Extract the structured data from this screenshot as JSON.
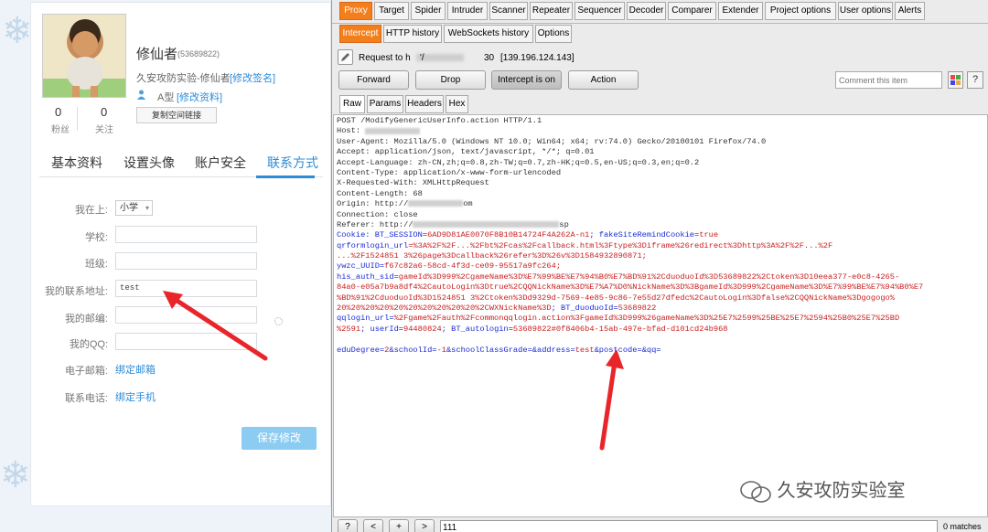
{
  "profile": {
    "name": "修仙者",
    "qq": "(53689822)",
    "signature": "久安攻防实验-修仙者",
    "edit_signature": "[修改签名]",
    "blood": "A型",
    "edit_info": "[修改资料]",
    "copy_btn": "复制空间链接",
    "fans_count": "0",
    "fans_label": "粉丝",
    "follow_count": "0",
    "follow_label": "关注"
  },
  "tabs": [
    "基本资料",
    "设置头像",
    "账户安全",
    "联系方式"
  ],
  "form": {
    "location_label": "我在上:",
    "location_value": "小学",
    "school_label": "学校:",
    "class_label": "班级:",
    "address_label": "我的联系地址:",
    "address_value": "test",
    "postcode_label": "我的邮编:",
    "qqnum_label": "我的QQ:",
    "email_label": "电子邮箱:",
    "email_link": "绑定邮箱",
    "phone_label": "联系电话:",
    "phone_link": "绑定手机",
    "save": "保存修改"
  },
  "burp": {
    "tools": [
      "Proxy",
      "Target",
      "Spider",
      "Intruder",
      "Scanner",
      "Repeater",
      "Sequencer",
      "Decoder",
      "Comparer",
      "Extender",
      "Project options",
      "User options",
      "Alerts"
    ],
    "subtabs": [
      "Intercept",
      "HTTP history",
      "WebSockets history",
      "Options"
    ],
    "request_prefix": "Request to h",
    "request_mid": "'/",
    "request_port": "30",
    "request_ip": "[139.196.124.143]",
    "buttons": {
      "forward": "Forward",
      "drop": "Drop",
      "intercept": "Intercept is on",
      "action": "Action"
    },
    "comment_placeholder": "Comment this item",
    "help": "?",
    "viewtabs": [
      "Raw",
      "Params",
      "Headers",
      "Hex"
    ],
    "lines": {
      "l1": "POST /ModifyGenericUserInfo.action HTTP/1.1",
      "l2": "Host: ",
      "l3": "User-Agent: Mozilla/5.0 (Windows NT 10.0; Win64; x64; rv:74.0) Gecko/20100101 Firefox/74.0",
      "l4": "Accept: application/json, text/javascript, */*; q=0.01",
      "l5": "Accept-Language: zh-CN,zh;q=0.8,zh-TW;q=0.7,zh-HK;q=0.5,en-US;q=0.3,en;q=0.2",
      "l6": "Content-Type: application/x-www-form-urlencoded",
      "l7": "X-Requested-With: XMLHttpRequest",
      "l8": "Content-Length: 68",
      "l9": "Origin: http://",
      "l9b": "om",
      "l10": "Connection: close",
      "l11": "Referer: http://",
      "l11b": "sp",
      "l12k": "Cookie: BT_SESSION=",
      "l12v": "6AD9D81AE0070F8B10B14724F4A262A-n1",
      "l12k2": "; fakeSiteRemindCookie=",
      "l12v2": "true",
      "l13k": "qrformlogin_url",
      "l13v": "=%3A%2F%2F...%2Fbt%2Fcas%2Fcallback.html%3Ftype%3Diframe%26redirect%3Dhttp%3A%2F%2F...%2F",
      "l14v": "...%2F1524851 3%26page%3Dcallback%26refer%3D%26v%3D1584932890871;",
      "l15k": "ywzc_UUID=",
      "l15v": "f67c82a6-58cd-4f3d-ce09-95517a9fc264;",
      "l16k": "his_auth_sid=",
      "l16v": "gameId%3D999%2CgameName%3D%E7%99%BE%E7%94%B0%E7%BD%91%2CduoduoId%3D53689822%2Ctoken%3D10eea377-e0c8-4265-",
      "l17v": "84a0-e05a7b9a8df4%2CautoLogin%3Dtrue%2CQQNickName%3D%E7%A7%D0%NickName%3D%3BgameId%3D999%2CgameName%3D%E7%99%BE%E7%94%B0%E7",
      "l18v": "%BD%91%2CduoduoId%3D1524851 3%2Ctoken%3Dd9329d-7569-4e85-9c86-7e55d27dfedc%2CautoLogin%3Dfalse%2CQQNickName%3Dgogogo%",
      "l19v": "20%20%20%20%20%20%20%20%20%20%2CWXNickName%3D",
      "l19k": "; BT_duoduoId=",
      "l19v2": "53689822",
      "l20k": "qqlogin_url=",
      "l20v": "%2Fgame%2Fauth%2Fcommonqqlogin.action%3FgameId%3D999%26gameName%3D%25E7%2599%25BE%25E7%2594%25B0%25E7%25BD",
      "l21v": "%2591",
      "l21k": "; userId=",
      "l21v2": "94480824",
      "l21k2": "; BT_autologin=",
      "l21v3": "53689822#0f8406b4-15ab-497e-bfad-d101cd24b968",
      "l22": "",
      "l23a": "eduDegree=",
      "l23b": "2",
      "l23c": "&schoolId=",
      "l23d": "-1",
      "l23e": "&schoolClassGrade=",
      "l23f": "",
      "l23g": "&address=",
      "l23h": "test",
      "l23i": "&postcode=",
      "l23j": "",
      "l23k": "&qq=",
      "l23l": ""
    },
    "search_value": "111",
    "matches": "0 matches",
    "nav_btns": [
      "?",
      "<",
      "+",
      ">"
    ]
  },
  "watermark": "久安攻防实验室",
  "colors": {
    "accent": "#f37f1c",
    "link": "#2d8bd6",
    "arrow": "#e8262a",
    "param_name": "#1c2bd3",
    "param_value": "#c92020"
  }
}
